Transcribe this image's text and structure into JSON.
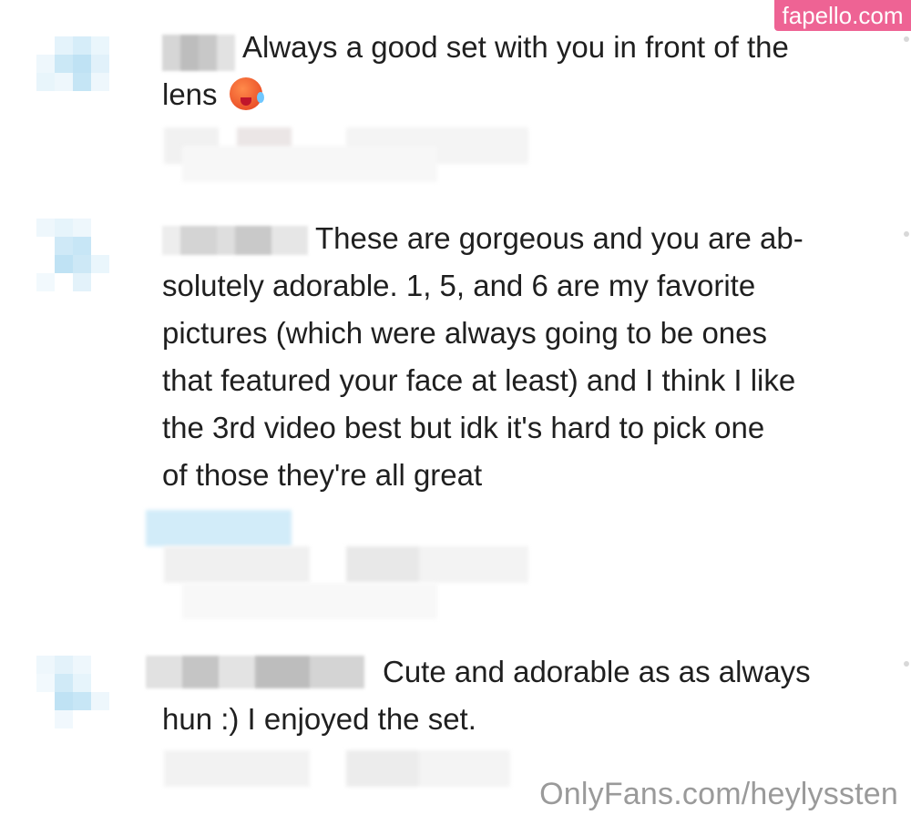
{
  "watermark_site": "fapello.com",
  "watermark_creator": "OnlyFans.com/heylyssten",
  "comments": [
    {
      "text_line1": "Always a good set with you in front of the",
      "text_line2": "lens",
      "emoji": "hot-face-emoji"
    },
    {
      "text_lines": [
        "These are gorgeous and you are ab-",
        "solutely adorable. 1, 5, and 6 are my favorite",
        "pictures (which were always going to be ones",
        "that featured your face at least) and I think I like",
        "the 3rd video best but idk it's hard to pick one",
        "of those they're all great"
      ]
    },
    {
      "text_lines": [
        "Cute and adorable as as always",
        "hun :) I enjoyed the set."
      ]
    }
  ],
  "colors": {
    "watermark_bg": "#ee6394",
    "avatar_blue": "#cfe9f7",
    "redact_gray": "#c9c9c9",
    "text": "#1f1f1f"
  }
}
